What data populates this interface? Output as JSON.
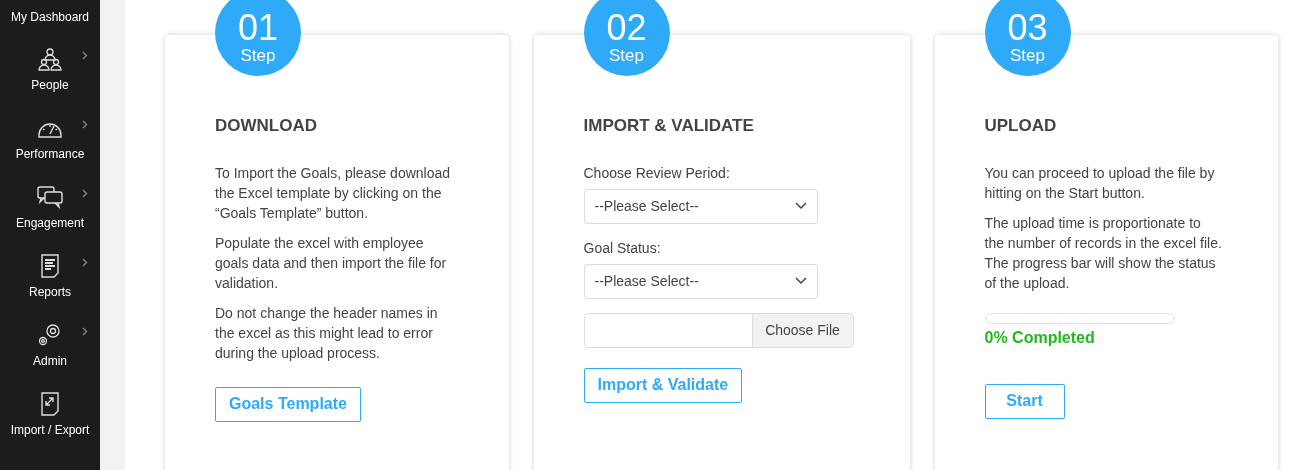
{
  "sidebar": {
    "top_link": "My Dashboard",
    "items": [
      {
        "label": "People",
        "has_submenu": true
      },
      {
        "label": "Performance",
        "has_submenu": true
      },
      {
        "label": "Engagement",
        "has_submenu": true
      },
      {
        "label": "Reports",
        "has_submenu": true
      },
      {
        "label": "Admin",
        "has_submenu": true
      },
      {
        "label": "Import / Export",
        "has_submenu": false
      }
    ]
  },
  "steps": [
    {
      "number": "01",
      "step_label": "Step",
      "title": "DOWNLOAD",
      "kind": "download",
      "paragraphs": [
        "To Import the Goals, please download the Excel template by clicking on the “Goals Template” button.",
        "Populate the excel with employee goals data and then import the file for validation.",
        "Do not change the header names in the excel as this might lead to error during the upload process."
      ],
      "button": "Goals Template"
    },
    {
      "number": "02",
      "step_label": "Step",
      "title": "IMPORT & VALIDATE",
      "kind": "import",
      "fields": [
        {
          "label": "Choose Review Period:",
          "value": "--Please Select--"
        },
        {
          "label": "Goal Status:",
          "value": "--Please Select--"
        }
      ],
      "file_button": "Choose File",
      "button": "Import & Validate"
    },
    {
      "number": "03",
      "step_label": "Step",
      "title": "UPLOAD",
      "kind": "upload",
      "paragraphs": [
        "You can proceed to upload the file by hitting on the Start button.",
        "The upload time is proportionate to the number of records in the excel file. The progress bar will show the status of the upload."
      ],
      "progress": {
        "level": 0,
        "reading": "0% Completed"
      },
      "button": "Start"
    }
  ]
}
